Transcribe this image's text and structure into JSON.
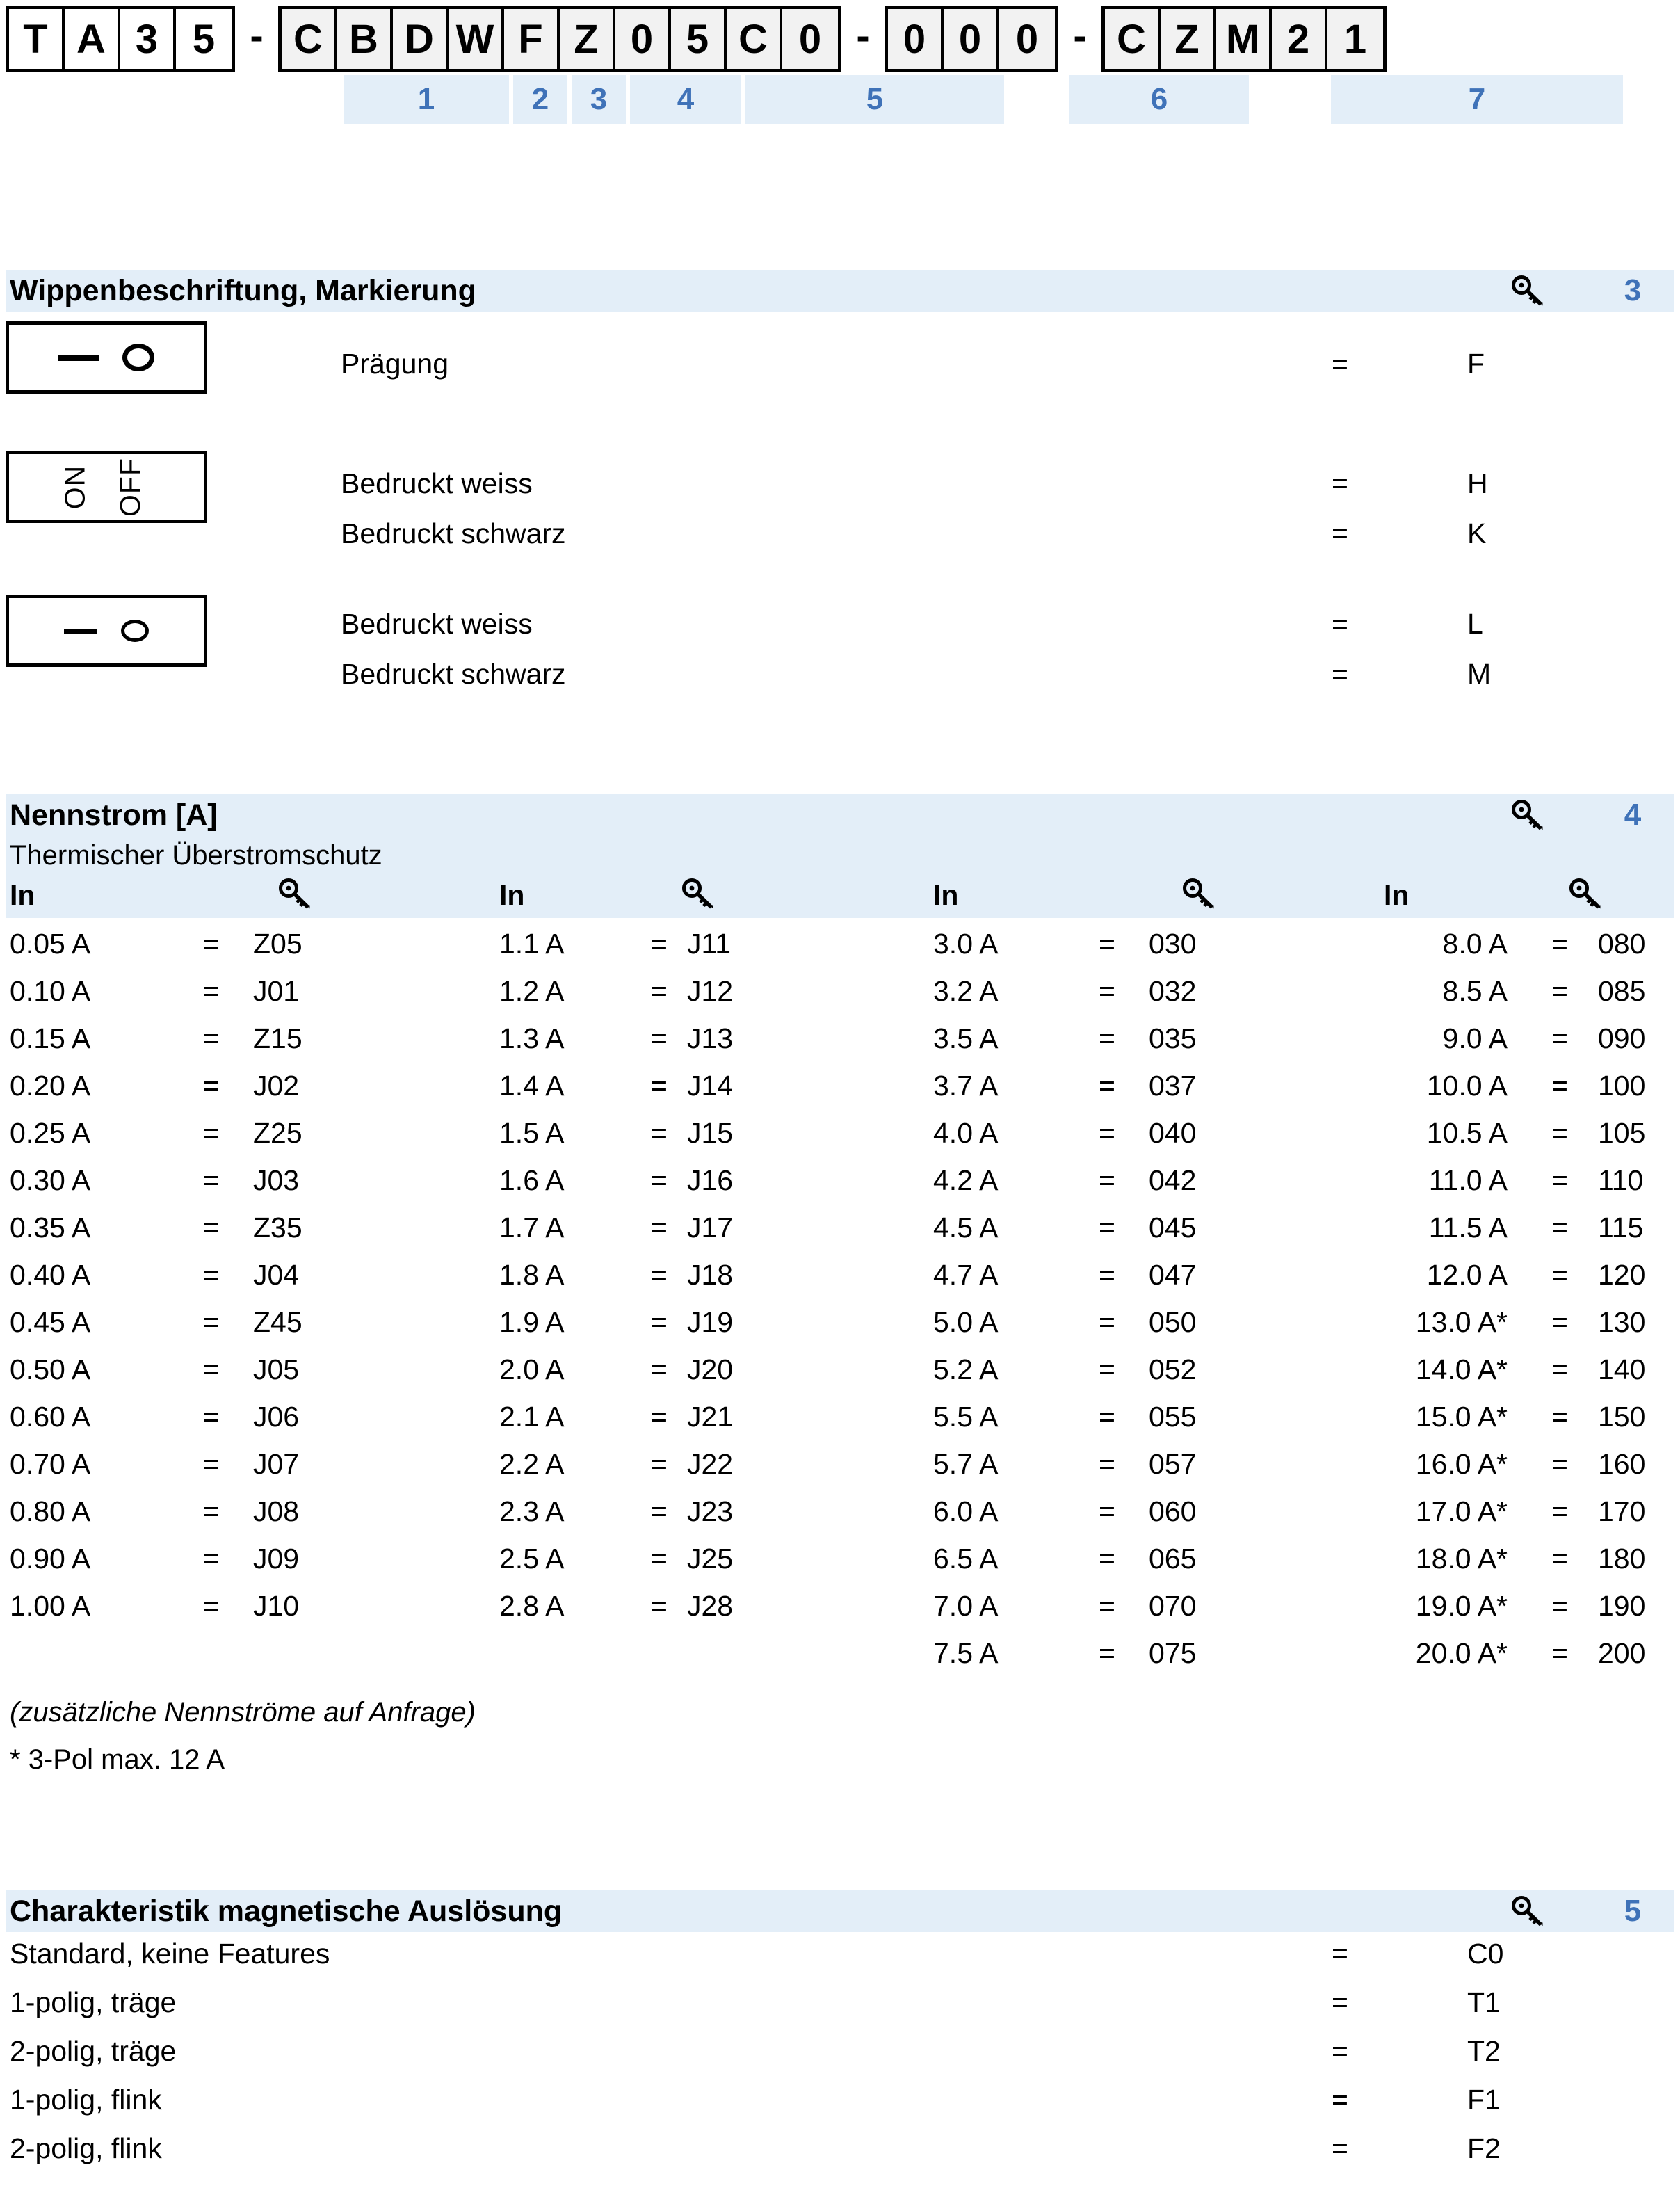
{
  "part_number": {
    "groups": [
      {
        "id": "base",
        "style": "white",
        "cells": [
          "T",
          "A",
          "3",
          "5"
        ]
      },
      {
        "id": "features",
        "style": "gray",
        "cells": [
          "C",
          "B",
          "D",
          "W",
          "F",
          "Z",
          "0",
          "5",
          "C",
          "0"
        ]
      },
      {
        "id": "aux",
        "style": "gray",
        "cells": [
          "0",
          "0",
          "0"
        ]
      },
      {
        "id": "terminal",
        "style": "gray",
        "cells": [
          "C",
          "Z",
          "M",
          "2",
          "1"
        ]
      }
    ],
    "separator": "-",
    "position_labels": [
      "1",
      "2",
      "3",
      "4",
      "5",
      "6",
      "7"
    ]
  },
  "sections": [
    {
      "id": "wippenbeschriftung",
      "title": "Wippenbeschriftung, Markierung",
      "key_icon": "key-icon",
      "number": "3",
      "entries": [
        {
          "symbol": "dash-circle-thick",
          "label": "Prägung",
          "eq": "=",
          "code": "F"
        },
        {
          "symbol": "on-off-vertical",
          "label": "Bedruckt weiss",
          "eq": "=",
          "code": "H"
        },
        {
          "symbol": "on-off-vertical",
          "label": "Bedruckt schwarz",
          "eq": "=",
          "code": "K"
        },
        {
          "symbol": "dash-circle-thin",
          "label": "Bedruckt weiss",
          "eq": "=",
          "code": "L"
        },
        {
          "symbol": "dash-circle-thin",
          "label": "Bedruckt schwarz",
          "eq": "=",
          "code": "M"
        }
      ],
      "symbol_texts": {
        "on": "ON",
        "off": "OFF"
      }
    },
    {
      "id": "nennstrom",
      "title": "Nennstrom [A]",
      "subtitle": "Thermischer Überstromschutz",
      "key_icon": "key-icon",
      "number": "4",
      "column_header": "In",
      "notes": [
        "(zusätzliche Nennströme auf Anfrage)",
        "* 3-Pol max. 12 A"
      ]
    },
    {
      "id": "charakteristik",
      "title": "Charakteristik magnetische Auslösung",
      "key_icon": "key-icon",
      "number": "5",
      "options": [
        {
          "label": "Standard, keine Features",
          "eq": "=",
          "code": "C0"
        },
        {
          "label": "1-polig, träge",
          "eq": "=",
          "code": "T1"
        },
        {
          "label": "2-polig, träge",
          "eq": "=",
          "code": "T2"
        },
        {
          "label": "1-polig, flink",
          "eq": "=",
          "code": "F1"
        },
        {
          "label": "2-polig, flink",
          "eq": "=",
          "code": "F2"
        }
      ]
    }
  ],
  "current_table": {
    "header": "In",
    "eq": "=",
    "columns": [
      {
        "index": 1,
        "rows": [
          {
            "current": "0.05 A",
            "code": "Z05"
          },
          {
            "current": "0.10 A",
            "code": "J01"
          },
          {
            "current": "0.15 A",
            "code": "Z15"
          },
          {
            "current": "0.20 A",
            "code": "J02"
          },
          {
            "current": "0.25 A",
            "code": "Z25"
          },
          {
            "current": "0.30 A",
            "code": "J03"
          },
          {
            "current": "0.35 A",
            "code": "Z35"
          },
          {
            "current": "0.40 A",
            "code": "J04"
          },
          {
            "current": "0.45 A",
            "code": "Z45"
          },
          {
            "current": "0.50 A",
            "code": "J05"
          },
          {
            "current": "0.60 A",
            "code": "J06"
          },
          {
            "current": "0.70 A",
            "code": "J07"
          },
          {
            "current": "0.80 A",
            "code": "J08"
          },
          {
            "current": "0.90 A",
            "code": "J09"
          },
          {
            "current": "1.00 A",
            "code": "J10"
          }
        ]
      },
      {
        "index": 2,
        "rows": [
          {
            "current": "1.1 A",
            "code": "J11"
          },
          {
            "current": "1.2 A",
            "code": "J12"
          },
          {
            "current": "1.3 A",
            "code": "J13"
          },
          {
            "current": "1.4 A",
            "code": "J14"
          },
          {
            "current": "1.5 A",
            "code": "J15"
          },
          {
            "current": "1.6 A",
            "code": "J16"
          },
          {
            "current": "1.7 A",
            "code": "J17"
          },
          {
            "current": "1.8 A",
            "code": "J18"
          },
          {
            "current": "1.9 A",
            "code": "J19"
          },
          {
            "current": "2.0 A",
            "code": "J20"
          },
          {
            "current": "2.1 A",
            "code": "J21"
          },
          {
            "current": "2.2 A",
            "code": "J22"
          },
          {
            "current": "2.3 A",
            "code": "J23"
          },
          {
            "current": "2.5 A",
            "code": "J25"
          },
          {
            "current": "2.8 A",
            "code": "J28"
          }
        ]
      },
      {
        "index": 3,
        "rows": [
          {
            "current": "3.0 A",
            "code": "030"
          },
          {
            "current": "3.2 A",
            "code": "032"
          },
          {
            "current": "3.5 A",
            "code": "035"
          },
          {
            "current": "3.7 A",
            "code": "037"
          },
          {
            "current": "4.0 A",
            "code": "040"
          },
          {
            "current": "4.2 A",
            "code": "042"
          },
          {
            "current": "4.5 A",
            "code": "045"
          },
          {
            "current": "4.7 A",
            "code": "047"
          },
          {
            "current": "5.0 A",
            "code": "050"
          },
          {
            "current": "5.2 A",
            "code": "052"
          },
          {
            "current": "5.5 A",
            "code": "055"
          },
          {
            "current": "5.7 A",
            "code": "057"
          },
          {
            "current": "6.0 A",
            "code": "060"
          },
          {
            "current": "6.5 A",
            "code": "065"
          },
          {
            "current": "7.0 A",
            "code": "070"
          },
          {
            "current": "7.5 A",
            "code": "075"
          }
        ]
      },
      {
        "index": 4,
        "rows": [
          {
            "current": "8.0 A",
            "code": "080"
          },
          {
            "current": "8.5 A",
            "code": "085"
          },
          {
            "current": "9.0 A",
            "code": "090"
          },
          {
            "current": "10.0 A",
            "code": "100"
          },
          {
            "current": "10.5 A",
            "code": "105"
          },
          {
            "current": "11.0 A",
            "code": "110"
          },
          {
            "current": "11.5 A",
            "code": "115"
          },
          {
            "current": "12.0 A",
            "code": "120"
          },
          {
            "current": "13.0 A*",
            "code": "130"
          },
          {
            "current": "14.0 A*",
            "code": "140"
          },
          {
            "current": "15.0 A*",
            "code": "150"
          },
          {
            "current": "16.0 A*",
            "code": "160"
          },
          {
            "current": "17.0 A*",
            "code": "170"
          },
          {
            "current": "18.0 A*",
            "code": "180"
          },
          {
            "current": "19.0 A*",
            "code": "190"
          },
          {
            "current": "20.0 A*",
            "code": "200"
          }
        ]
      }
    ]
  },
  "colors": {
    "header_band": "#e3eef8",
    "accent_blue": "#3f72b8",
    "cell_gray": "#f2f2f2",
    "ink": "#000000"
  }
}
